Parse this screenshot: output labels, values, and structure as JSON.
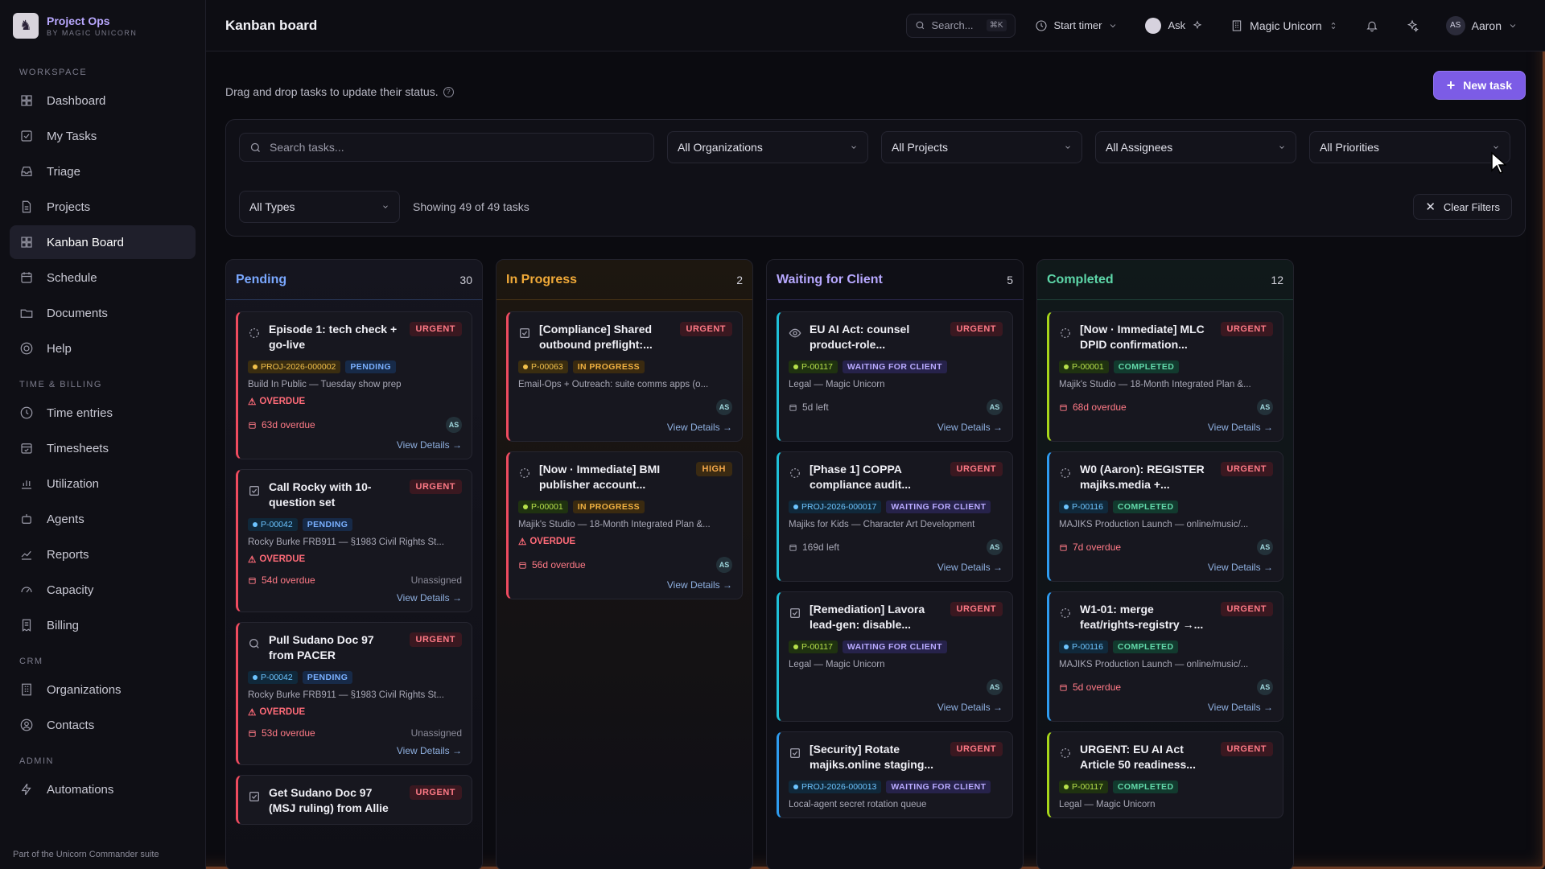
{
  "app": {
    "name": "Project Ops",
    "sub": "BY MAGIC UNICORN",
    "footer": "Part of the Unicorn Commander suite"
  },
  "sidebar": {
    "workspace_label": "WORKSPACE",
    "workspace": [
      {
        "label": "Dashboard",
        "icon": "grid-icon"
      },
      {
        "label": "My Tasks",
        "icon": "check-square-icon"
      },
      {
        "label": "Triage",
        "icon": "inbox-icon"
      },
      {
        "label": "Projects",
        "icon": "file-icon"
      },
      {
        "label": "Kanban Board",
        "icon": "kanban-icon"
      },
      {
        "label": "Schedule",
        "icon": "calendar-icon"
      },
      {
        "label": "Documents",
        "icon": "folder-icon"
      },
      {
        "label": "Help",
        "icon": "help-icon"
      }
    ],
    "time_label": "TIME & BILLING",
    "time": [
      {
        "label": "Time entries",
        "icon": "clock-icon"
      },
      {
        "label": "Timesheets",
        "icon": "calendar-check-icon"
      },
      {
        "label": "Utilization",
        "icon": "bar-chart-icon"
      },
      {
        "label": "Agents",
        "icon": "bot-icon"
      },
      {
        "label": "Reports",
        "icon": "trend-icon"
      },
      {
        "label": "Capacity",
        "icon": "gauge-icon"
      },
      {
        "label": "Billing",
        "icon": "receipt-icon"
      }
    ],
    "crm_label": "CRM",
    "crm": [
      {
        "label": "Organizations",
        "icon": "building-icon"
      },
      {
        "label": "Contacts",
        "icon": "contact-icon"
      }
    ],
    "admin_label": "ADMIN",
    "admin": [
      {
        "label": "Automations",
        "icon": "bolt-icon"
      }
    ]
  },
  "topbar": {
    "title": "Kanban board",
    "search": "Search...",
    "kbd": "⌘K",
    "timer": "Start timer",
    "ask": "Ask",
    "org": "Magic Unicorn",
    "user_initials": "AS",
    "user": "Aaron"
  },
  "page": {
    "subtitle": "Drag and drop tasks to update their status.",
    "new_task": "New task"
  },
  "filters": {
    "search_placeholder": "Search tasks...",
    "orgs": "All Organizations",
    "projects": "All Projects",
    "assignees": "All Assignees",
    "priorities": "All Priorities",
    "types": "All Types",
    "showing": "Showing 49 of 49 tasks",
    "clear": "Clear Filters"
  },
  "columns": [
    {
      "title": "Pending",
      "count": "30",
      "cards": [
        {
          "title": "Episode 1: tech check + go-live",
          "priority": "URGENT",
          "project": "PROJ-2026-000002",
          "status": "PENDING",
          "desc": "Build In Public — Tuesday show prep",
          "overdue": "OVERDUE",
          "due": "63d overdue",
          "assignee": "AS",
          "link": "View Details →"
        },
        {
          "title": "Call Rocky with 10-question set",
          "priority": "URGENT",
          "project": "P-00042",
          "status": "PENDING",
          "desc": "Rocky Burke FRB911 — §1983 Civil Rights St...",
          "overdue": "OVERDUE",
          "due": "54d overdue",
          "assignee": "Unassigned",
          "link": "View Details →"
        },
        {
          "title": "Pull Sudano Doc 97 from PACER",
          "priority": "URGENT",
          "project": "P-00042",
          "status": "PENDING",
          "desc": "Rocky Burke FRB911 — §1983 Civil Rights St...",
          "overdue": "OVERDUE",
          "due": "53d overdue",
          "assignee": "Unassigned",
          "link": "View Details →"
        },
        {
          "title": "Get Sudano Doc 97 (MSJ ruling) from Allie",
          "priority": "URGENT"
        }
      ]
    },
    {
      "title": "In Progress",
      "count": "2",
      "cards": [
        {
          "title": "[Compliance] Shared outbound preflight:...",
          "priority": "URGENT",
          "project": "P-00063",
          "status": "IN PROGRESS",
          "desc": "Email-Ops + Outreach: suite comms apps (o...",
          "assignee": "AS",
          "link": "View Details →"
        },
        {
          "title": "[Now · Immediate] BMI publisher account...",
          "priority": "HIGH",
          "project": "P-00001",
          "status": "IN PROGRESS",
          "desc": "Majik's Studio — 18-Month Integrated Plan &...",
          "overdue": "OVERDUE",
          "due": "56d overdue",
          "assignee": "AS",
          "link": "View Details →"
        }
      ]
    },
    {
      "title": "Waiting for Client",
      "count": "5",
      "cards": [
        {
          "title": "EU AI Act: counsel product-role...",
          "priority": "URGENT",
          "project": "P-00117",
          "status": "WAITING FOR CLIENT",
          "desc": "Legal — Magic Unicorn",
          "due": "5d left",
          "assignee": "AS",
          "link": "View Details →"
        },
        {
          "title": "[Phase 1] COPPA compliance audit...",
          "priority": "URGENT",
          "project": "PROJ-2026-000017",
          "status": "WAITING FOR CLIENT",
          "desc": "Majiks for Kids — Character Art Development",
          "due": "169d left",
          "assignee": "AS",
          "link": "View Details →"
        },
        {
          "title": "[Remediation] Lavora lead-gen: disable...",
          "priority": "URGENT",
          "project": "P-00117",
          "status": "WAITING FOR CLIENT",
          "desc": "Legal — Magic Unicorn",
          "assignee": "AS",
          "link": "View Details →"
        },
        {
          "title": "[Security] Rotate majiks.online staging...",
          "priority": "URGENT",
          "project": "PROJ-2026-000013",
          "status": "WAITING FOR CLIENT",
          "desc": "Local-agent secret rotation queue"
        }
      ]
    },
    {
      "title": "Completed",
      "count": "12",
      "cards": [
        {
          "title": "[Now · Immediate] MLC DPID confirmation...",
          "priority": "URGENT",
          "project": "P-00001",
          "status": "COMPLETED",
          "desc": "Majik's Studio — 18-Month Integrated Plan &...",
          "due": "68d overdue",
          "assignee": "AS",
          "link": "View Details →"
        },
        {
          "title": "W0 (Aaron): REGISTER majiks.media +...",
          "priority": "URGENT",
          "project": "P-00116",
          "status": "COMPLETED",
          "desc": "MAJIKS Production Launch — online/music/...",
          "due": "7d overdue",
          "assignee": "AS",
          "link": "View Details →"
        },
        {
          "title": "W1-01: merge feat/rights-registry →...",
          "priority": "URGENT",
          "project": "P-00116",
          "status": "COMPLETED",
          "desc": "MAJIKS Production Launch — online/music/...",
          "due": "5d overdue",
          "assignee": "AS",
          "link": "View Details →"
        },
        {
          "title": "URGENT: EU AI Act Article 50 readiness...",
          "priority": "URGENT",
          "project": "P-00117",
          "status": "COMPLETED",
          "desc": "Legal — Magic Unicorn"
        }
      ]
    }
  ]
}
